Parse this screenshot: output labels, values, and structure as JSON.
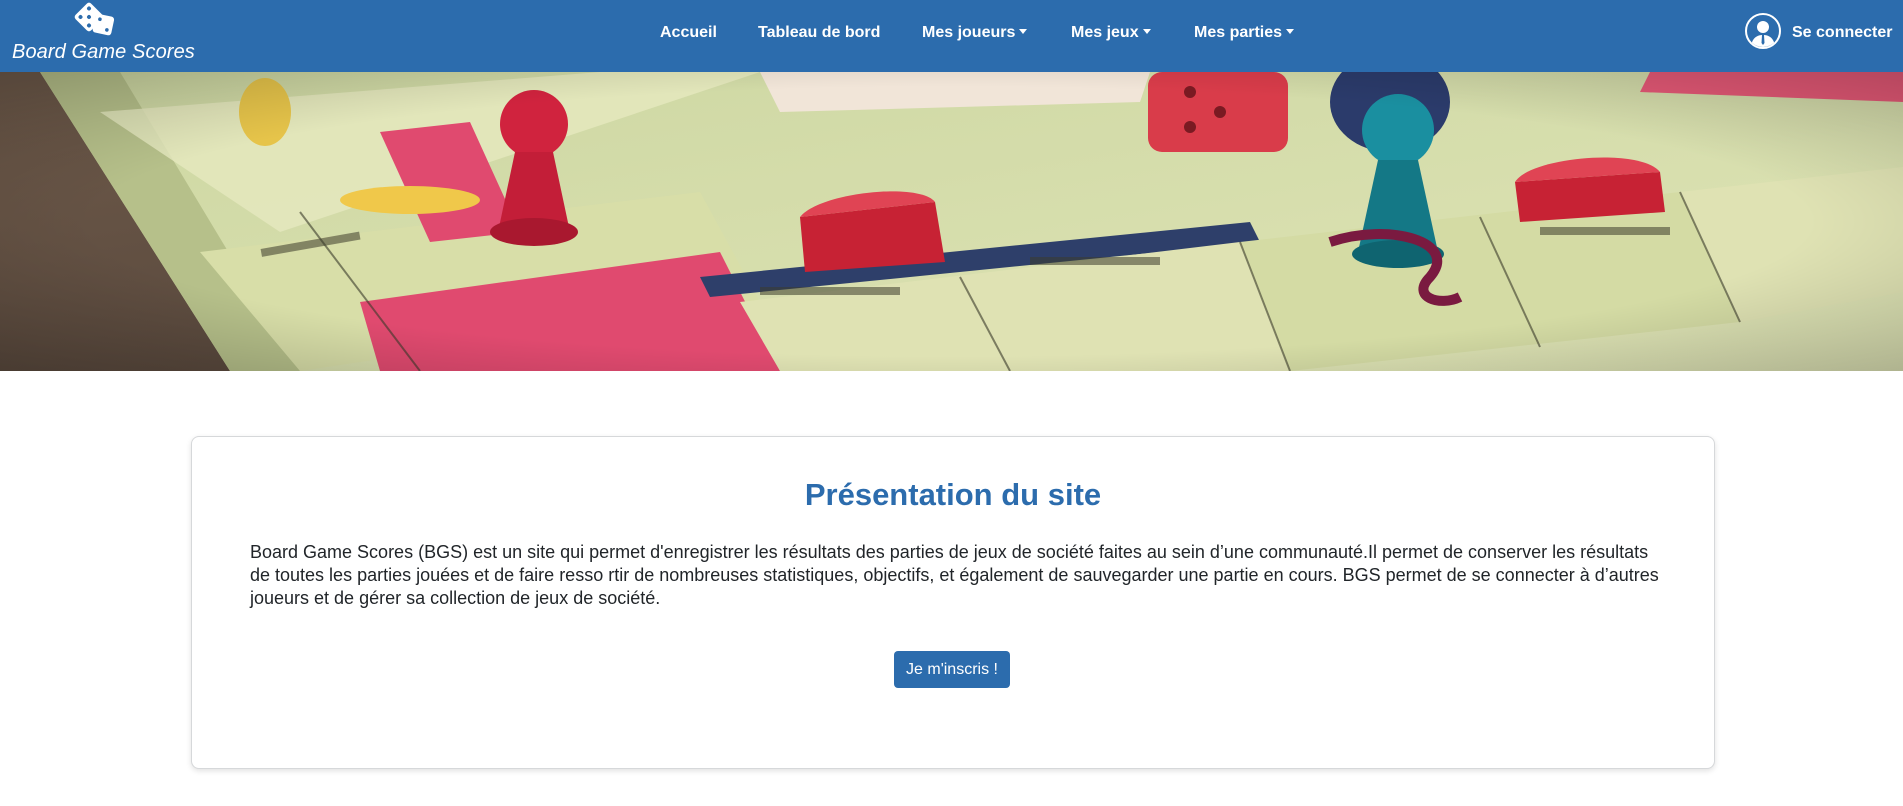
{
  "brand": {
    "name": "Board Game Scores",
    "icon": "dice-icon"
  },
  "nav": {
    "items": [
      {
        "label": "Accueil",
        "dropdown": false
      },
      {
        "label": "Tableau de bord",
        "dropdown": false
      },
      {
        "label": "Mes joueurs",
        "dropdown": true
      },
      {
        "label": "Mes jeux",
        "dropdown": true
      },
      {
        "label": "Mes parties",
        "dropdown": true
      }
    ],
    "login_label": "Se connecter",
    "login_icon": "user-avatar-icon"
  },
  "hero": {
    "image": "board-game-monopoly-photo"
  },
  "presentation": {
    "title": "Présentation du site",
    "text": "Board Game Scores (BGS) est un site qui permet d'enregistrer les résultats des parties de jeux de société faites au sein d’une communauté.Il permet de conserver les résultats de toutes les parties jouées et de faire resso rtir de nombreuses statistiques, objectifs, et également de sauvegarder une partie en cours. BGS permet de se connecter à d’autres joueurs et de gérer sa collection de jeux de société.",
    "button_label": "Je m'inscris !"
  },
  "colors": {
    "primary": "#2c6cad",
    "text": "#212529",
    "background": "#ffffff"
  }
}
